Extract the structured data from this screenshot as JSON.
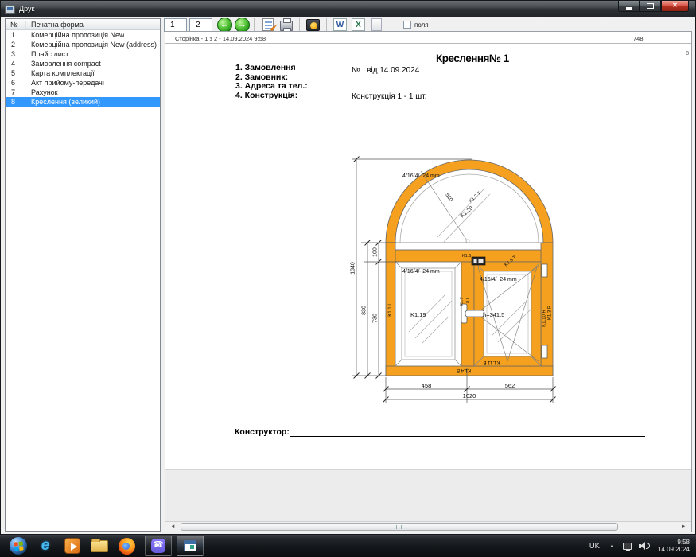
{
  "window": {
    "title": "Друк"
  },
  "sidebar": {
    "headers": {
      "num": "№",
      "form": "Печатна форма"
    },
    "items": [
      {
        "num": "1",
        "label": "Комерційна пропозиція New"
      },
      {
        "num": "2",
        "label": "Комерційна пропозиція New (address)"
      },
      {
        "num": "3",
        "label": "Прайс лист"
      },
      {
        "num": "4",
        "label": "Замовлення compact"
      },
      {
        "num": "5",
        "label": "Карта комплектації"
      },
      {
        "num": "6",
        "label": "Акт прийому-передачі"
      },
      {
        "num": "7",
        "label": "Рахунок"
      },
      {
        "num": "8",
        "label": "Креслення (великий)"
      }
    ],
    "selected_index": 7
  },
  "toolbar": {
    "page_current": "1",
    "page_total": "2",
    "icons": [
      "nav-back",
      "nav-forward",
      "report-designer",
      "print",
      "image-export",
      "word-export",
      "excel-export",
      "plain-page"
    ],
    "fields_label": "поля"
  },
  "preview": {
    "status": "Сторінка - 1 з 2 - 14.09.2024 9:58",
    "counter": "748",
    "marker": "8"
  },
  "document": {
    "title": "Креслення№ 1",
    "items": [
      "1. Замовлення",
      "2. Замовник:",
      "3. Адреса та тел.:",
      "4. Конструкція:"
    ],
    "order_line": "№   від 14.09.2024",
    "construction_line": "Конструкція 1 - 1 шт.",
    "constructor_label": "Конструктор:"
  },
  "drawing": {
    "accent_color": "#F5A01E",
    "labels": {
      "glass_arch": "4/16/4/  24 mm",
      "glass_left": "4/16/4/  24 mm",
      "glass_right": "4/16/4/  24 mm",
      "dim_total_h": "1340",
      "dim_830": "830",
      "dim_730": "730",
      "dim_100": "100",
      "dim_arc": "510",
      "dim_left_w": "458",
      "dim_right_w": "562",
      "dim_total_w": "1020",
      "k12t": "K1.2 T",
      "k120": "K1.20",
      "k16": "K1.6",
      "k19t": "K1.9 T",
      "k119": "K1.19",
      "handle_h": "h=341,5",
      "k11l": "K1.1 L",
      "k17": "K1.7",
      "l8": "8 L",
      "k110r": "K1.10 R",
      "k13r": "K1.3 R",
      "k14b": "K1.4 B",
      "k111b": "K1.11 B"
    }
  },
  "taskbar": {
    "language": "UK",
    "time": "9:58",
    "date": "14.09.2024"
  }
}
